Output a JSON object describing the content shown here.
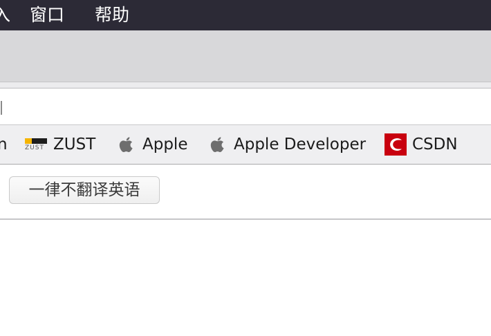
{
  "menubar": {
    "partial_item": "入",
    "window": "窗口",
    "help": "帮助",
    "background": "#2c2a36"
  },
  "address": {
    "caret_visible": true
  },
  "bookmarks": [
    {
      "label": "n",
      "icon": "none"
    },
    {
      "label": "ZUST",
      "icon": "zust-logo-icon",
      "icon_text": "ZUST"
    },
    {
      "label": "Apple",
      "icon": "apple-icon"
    },
    {
      "label": "Apple Developer",
      "icon": "apple-icon"
    },
    {
      "label": "CSDN",
      "icon": "csdn-logo-icon",
      "icon_color": "#c8000f"
    }
  ],
  "translate": {
    "never_translate_label": "一律不翻译英语"
  }
}
